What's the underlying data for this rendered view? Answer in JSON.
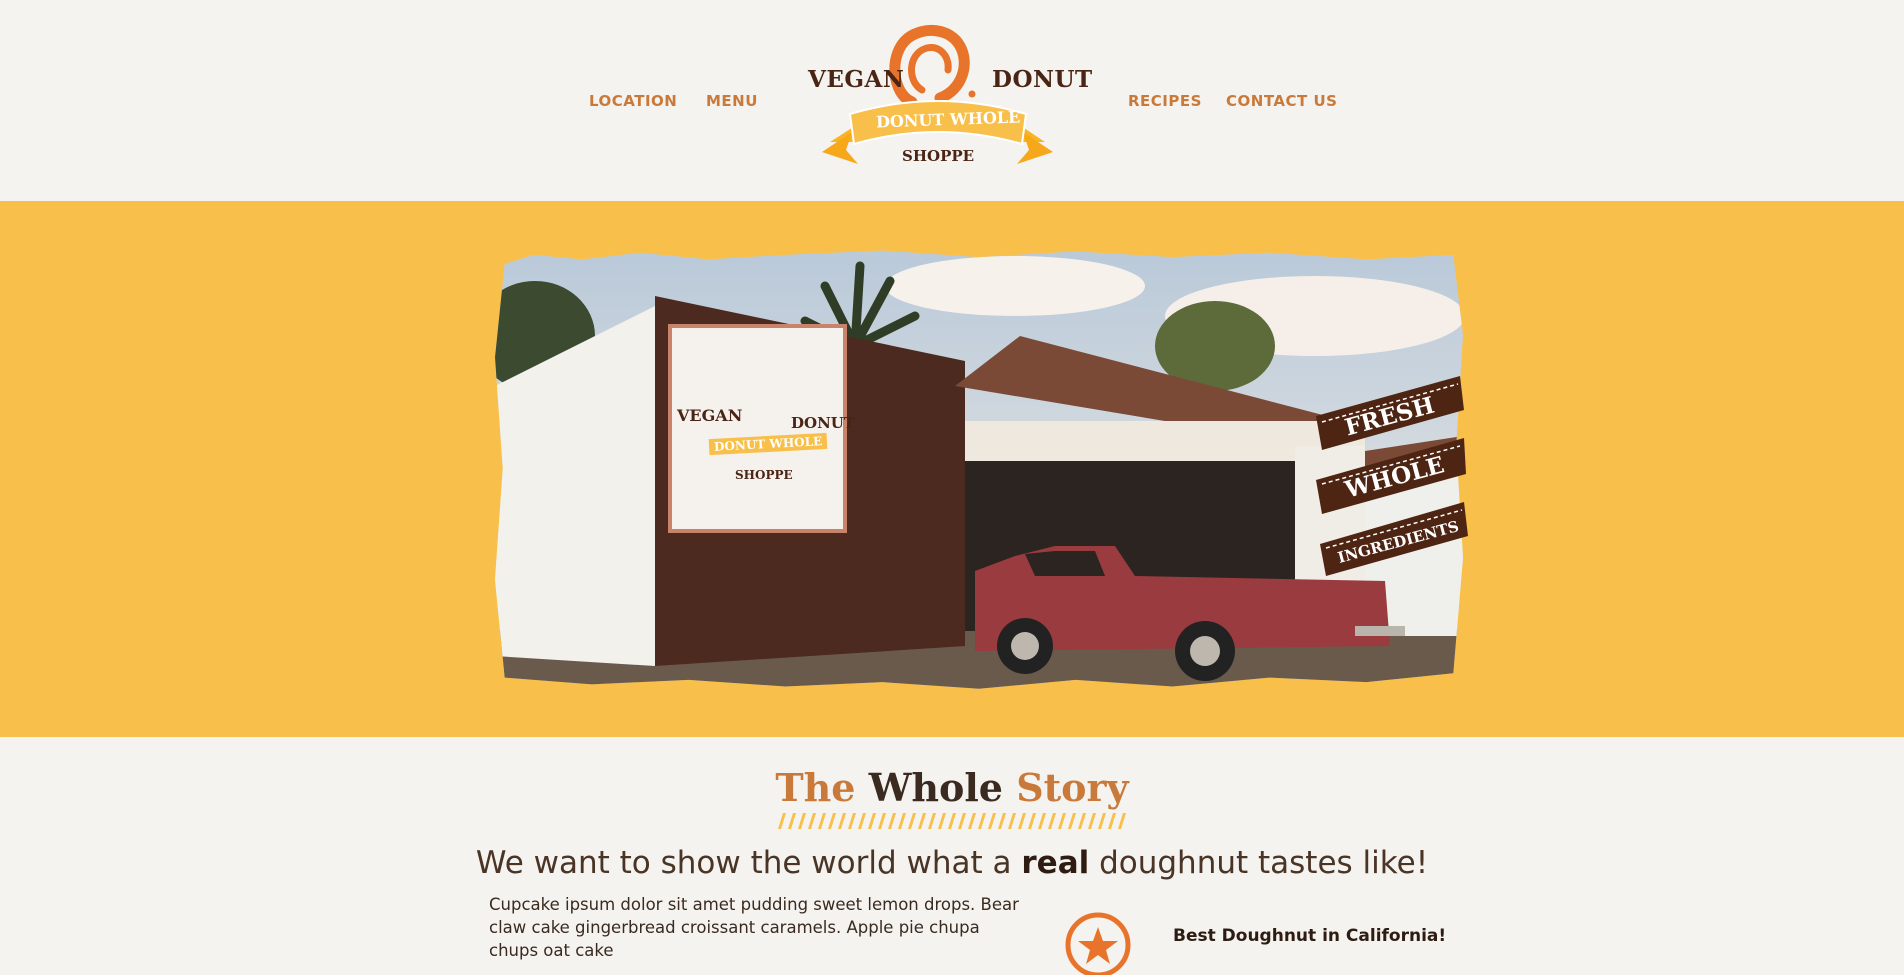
{
  "nav": {
    "left": [
      "LOCATION",
      "MENU"
    ],
    "right": [
      "RECIPES",
      "CONTACT US"
    ]
  },
  "logo": {
    "word_left": "VEGAN",
    "word_right": "DONUT",
    "banner": "DONUT WHOLE",
    "sub": "SHOPPE"
  },
  "hero": {
    "ribbon": [
      "FRESH",
      "WHOLE",
      "INGREDIENTS"
    ],
    "sign": {
      "word_left": "VEGAN",
      "word_right": "DONUT",
      "banner": "DONUT WHOLE",
      "sub": "SHOPPE"
    }
  },
  "story": {
    "title_1": "The",
    "title_2": "Whole",
    "title_3": "Story",
    "tagline_pre": "We want to show the world what a ",
    "tagline_bold": "real",
    "tagline_post": " doughnut tastes like!",
    "body": "Cupcake ipsum dolor sit amet pudding sweet lemon drops. Bear claw cake gingerbread croissant caramels. Apple pie chupa chups oat cake",
    "award": "Best Doughnut in California!"
  },
  "colors": {
    "accent": "#f8c04a",
    "brand_orange": "#c97a3a",
    "brown": "#4a2414",
    "background": "#f4f3ef"
  }
}
